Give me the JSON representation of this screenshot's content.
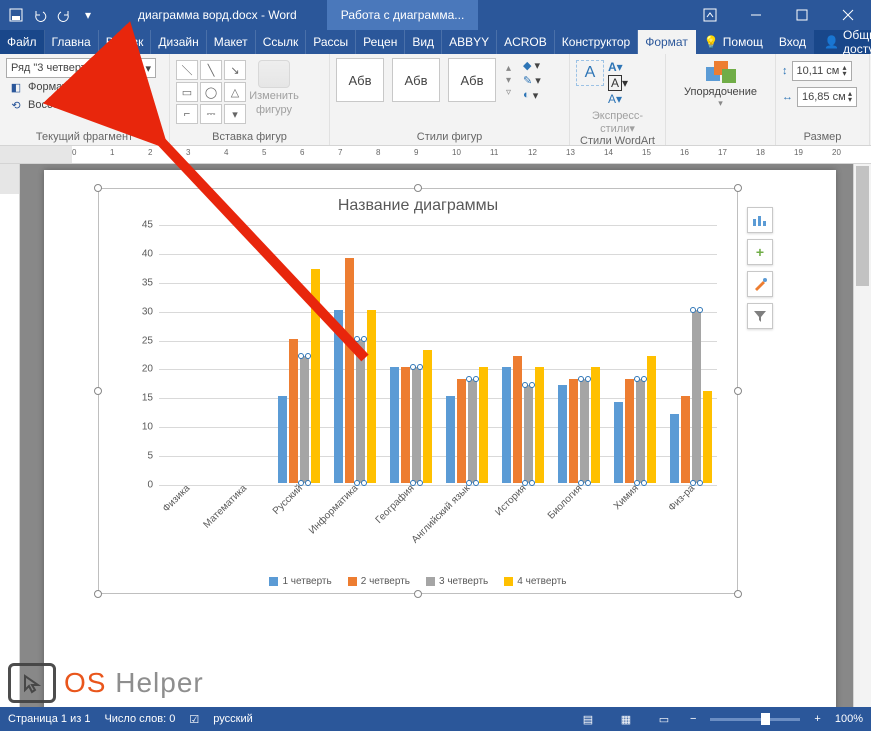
{
  "titlebar": {
    "doc_title": "диаграмма ворд.docx - Word",
    "context_tab": "Работа с диаграмма..."
  },
  "tabs": {
    "items": [
      "Файл",
      "Главна",
      "Вставк",
      "Дизайн",
      "Макет",
      "Ссылк",
      "Рассы",
      "Рецен",
      "Вид",
      "ABBYY",
      "ACROB",
      "Конструктор",
      "Формат"
    ],
    "active_index": 12,
    "help": "Помощ",
    "login": "Вход",
    "share": "Общий доступ"
  },
  "ribbon": {
    "selection": {
      "combo": "Ряд \"3 четверть\"",
      "format_sel": "Формат выделенного",
      "reset": "Восстановить стиль",
      "label": "Текущий фрагмент"
    },
    "shapes": {
      "change": "Изменить",
      "figure": "фигуру",
      "label": "Вставка фигур"
    },
    "styles": {
      "sample": "Абв",
      "fill": "",
      "outline": "",
      "effects": "",
      "label": "Стили фигур"
    },
    "wordart": {
      "express": "Экспресс-",
      "styles": "стили",
      "label": "Стили WordArt"
    },
    "arrange": {
      "btn": "Упорядочение",
      "label": ""
    },
    "size": {
      "h": "10,11 см",
      "w": "16,85 см",
      "label": "Размер"
    }
  },
  "chart_data": {
    "type": "bar",
    "title": "Название диаграммы",
    "categories": [
      "Физика",
      "Математика",
      "Русский",
      "Информатика",
      "География",
      "Английский язык",
      "История",
      "Биология",
      "Химия",
      "Физ-ра"
    ],
    "series": [
      {
        "name": "1 четверть",
        "color": "#5b9bd5",
        "values": [
          0,
          0,
          15,
          30,
          20,
          15,
          20,
          17,
          14,
          12
        ]
      },
      {
        "name": "2 четверть",
        "color": "#ed7d31",
        "values": [
          0,
          0,
          25,
          39,
          20,
          18,
          22,
          18,
          18,
          15
        ]
      },
      {
        "name": "3 четверть",
        "color": "#a5a5a5",
        "values": [
          0,
          0,
          22,
          25,
          20,
          18,
          17,
          18,
          18,
          30
        ]
      },
      {
        "name": "4 четверть",
        "color": "#ffc000",
        "values": [
          0,
          0,
          37,
          30,
          23,
          20,
          20,
          20,
          22,
          16
        ]
      }
    ],
    "ylim": [
      0,
      45
    ],
    "yticks": [
      0,
      5,
      10,
      15,
      20,
      25,
      30,
      35,
      40,
      45
    ],
    "selected_series_index": 2
  },
  "status": {
    "page": "Страница 1 из 1",
    "words": "Число слов: 0",
    "lang": "русский",
    "zoom": "100%"
  },
  "logo": {
    "p1": "OS ",
    "p2": "Helper"
  }
}
